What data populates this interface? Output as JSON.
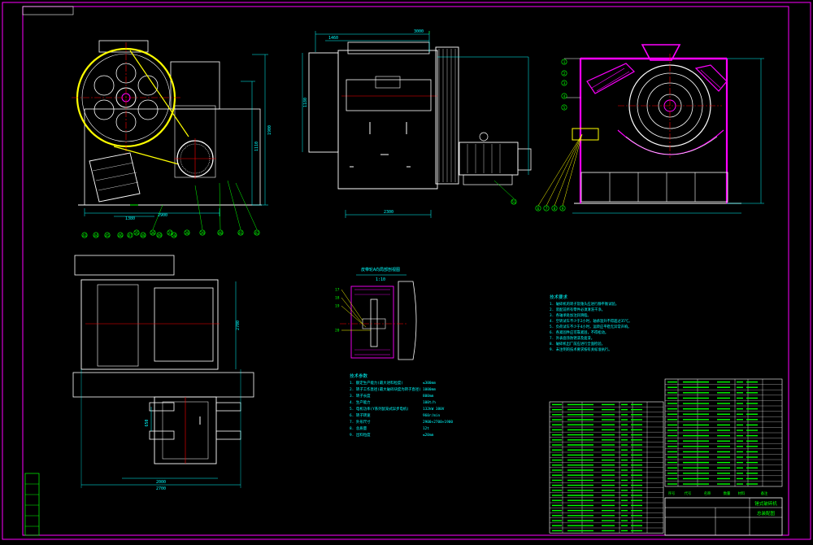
{
  "dimensions": {
    "v1_overall_width": "2900",
    "v1_base_span": "1380",
    "v1_total_height": "1900",
    "v1_height_ref": "1110",
    "v2_width": "3000",
    "v2_width_b": "2300",
    "v2_top": "1460",
    "v2_height": "1180",
    "v4_span_a": "2000",
    "v4_span_b": "2700",
    "v4_height": "2700",
    "v4_offset": "650",
    "v4_side": "2930"
  },
  "balloons": {
    "v1_bottom": [
      "35",
      "36",
      "37",
      "38",
      "39",
      "40",
      "41",
      "42"
    ],
    "v3_left": [
      "1",
      "2",
      "3",
      "4",
      "5",
      "6",
      "7",
      "8",
      "9"
    ],
    "v4_top": [
      "43",
      "44",
      "45",
      "46",
      "47",
      "48",
      "49",
      "50"
    ],
    "v2_right": [
      "51"
    ]
  },
  "section_title": "皮带轮A向局部剖视图",
  "section_scale": "1:10",
  "section_labels": [
    "17",
    "18",
    "19",
    "20"
  ],
  "spec_title": "技术参数",
  "spec_rows": [
    {
      "k": "1. 额定生产能力(最大进料粒度)",
      "v": "≤300mm"
    },
    {
      "k": "2. 转子工作直径(最大破碎块度为转子直径)",
      "v": "1000mm"
    },
    {
      "k": "3. 转子长度",
      "v": "800mm"
    },
    {
      "k": "4. 生产能力",
      "v": "100t/h"
    },
    {
      "k": "5. 电机功率(Y系列鼠笼式异步电机)",
      "v": "132kW  380V"
    },
    {
      "k": "6. 转子转速",
      "v": "960r/min"
    },
    {
      "k": "7. 外形尺寸",
      "v": "2900×2700×1900"
    },
    {
      "k": "8. 总质量",
      "v": "12t"
    },
    {
      "k": "9. 出料粒度",
      "v": "≤20mm"
    }
  ],
  "notes_title": "技术要求",
  "notes": [
    "1. 破碎机的转子及锤头应进行静平衡试验。",
    "2. 装配前所有零件必须清洗干净。",
    "3. 各轴承处加注润滑脂。",
    "4. 空转试车不少于2小时，轴承温升不得超过35℃。",
    "5. 负荷试车不少于4小时，运转应平稳无异常声响。",
    "6. 各紧固件应可靠紧固，不得松动。",
    "7. 外表面涂防锈漆及面漆。",
    "8. 破碎机出厂前应进行全面检验。",
    "9. 未注明的技术要求按有关标准执行。"
  ],
  "title_block": {
    "name": "锤式破碎机",
    "sub": "总装配图",
    "header": [
      "序号",
      "代号",
      "名称",
      "数量",
      "材料",
      "备注"
    ]
  },
  "colors": {
    "bg": "#000000",
    "frame": "#ff00ff",
    "outline": "#ffffff",
    "center": "#ff0000",
    "dim": "#00ffff",
    "parts": "#00ff00",
    "hatch": "#ff00ff",
    "yellow": "#ffff00"
  }
}
